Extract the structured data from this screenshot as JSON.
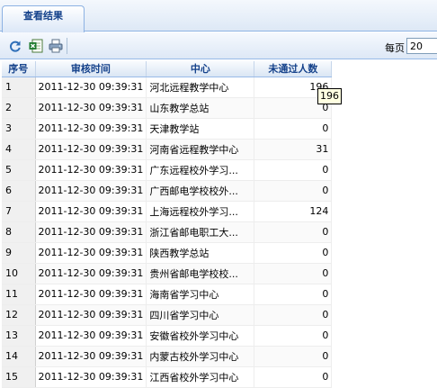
{
  "tabs": [
    {
      "label": "查看结果"
    }
  ],
  "toolbar": {
    "page_size_label": "每页",
    "page_size_value": "20"
  },
  "icons": {
    "refresh": "refresh-icon",
    "excel": "excel-export-icon",
    "print": "print-icon"
  },
  "colors": {
    "header_text": "#15428b",
    "border": "#99bbe8",
    "toolbar_bg": "#dde8f6"
  },
  "grid": {
    "columns": [
      "序号",
      "审核时间",
      "中心",
      "未通过人数"
    ],
    "rows": [
      {
        "no": "1",
        "time": "2011-12-30 09:39:31",
        "center": "河北远程教学中心",
        "count": "196"
      },
      {
        "no": "2",
        "time": "2011-12-30 09:39:31",
        "center": "山东教学总站",
        "count": "0"
      },
      {
        "no": "3",
        "time": "2011-12-30 09:39:31",
        "center": "天津教学站",
        "count": "0"
      },
      {
        "no": "4",
        "time": "2011-12-30 09:39:31",
        "center": "河南省远程教学中心",
        "count": "31"
      },
      {
        "no": "5",
        "time": "2011-12-30 09:39:31",
        "center": "广东远程校外学习...",
        "count": "0"
      },
      {
        "no": "6",
        "time": "2011-12-30 09:39:31",
        "center": "广西邮电学校校外...",
        "count": "0"
      },
      {
        "no": "7",
        "time": "2011-12-30 09:39:31",
        "center": "上海远程校外学习...",
        "count": "124"
      },
      {
        "no": "8",
        "time": "2011-12-30 09:39:31",
        "center": "浙江省邮电职工大...",
        "count": "0"
      },
      {
        "no": "9",
        "time": "2011-12-30 09:39:31",
        "center": "陕西教学总站",
        "count": "0"
      },
      {
        "no": "10",
        "time": "2011-12-30 09:39:31",
        "center": "贵州省邮电学校校...",
        "count": "0"
      },
      {
        "no": "11",
        "time": "2011-12-30 09:39:31",
        "center": "海南省学习中心",
        "count": "0"
      },
      {
        "no": "12",
        "time": "2011-12-30 09:39:31",
        "center": "四川省学习中心",
        "count": "0"
      },
      {
        "no": "13",
        "time": "2011-12-30 09:39:31",
        "center": "安徽省校外学习中心",
        "count": "0"
      },
      {
        "no": "14",
        "time": "2011-12-30 09:39:31",
        "center": "内蒙古校外学习中心",
        "count": "0"
      },
      {
        "no": "15",
        "time": "2011-12-30 09:39:31",
        "center": "江西省校外学习中心",
        "count": "0"
      }
    ]
  },
  "tooltip": {
    "text": "196"
  }
}
